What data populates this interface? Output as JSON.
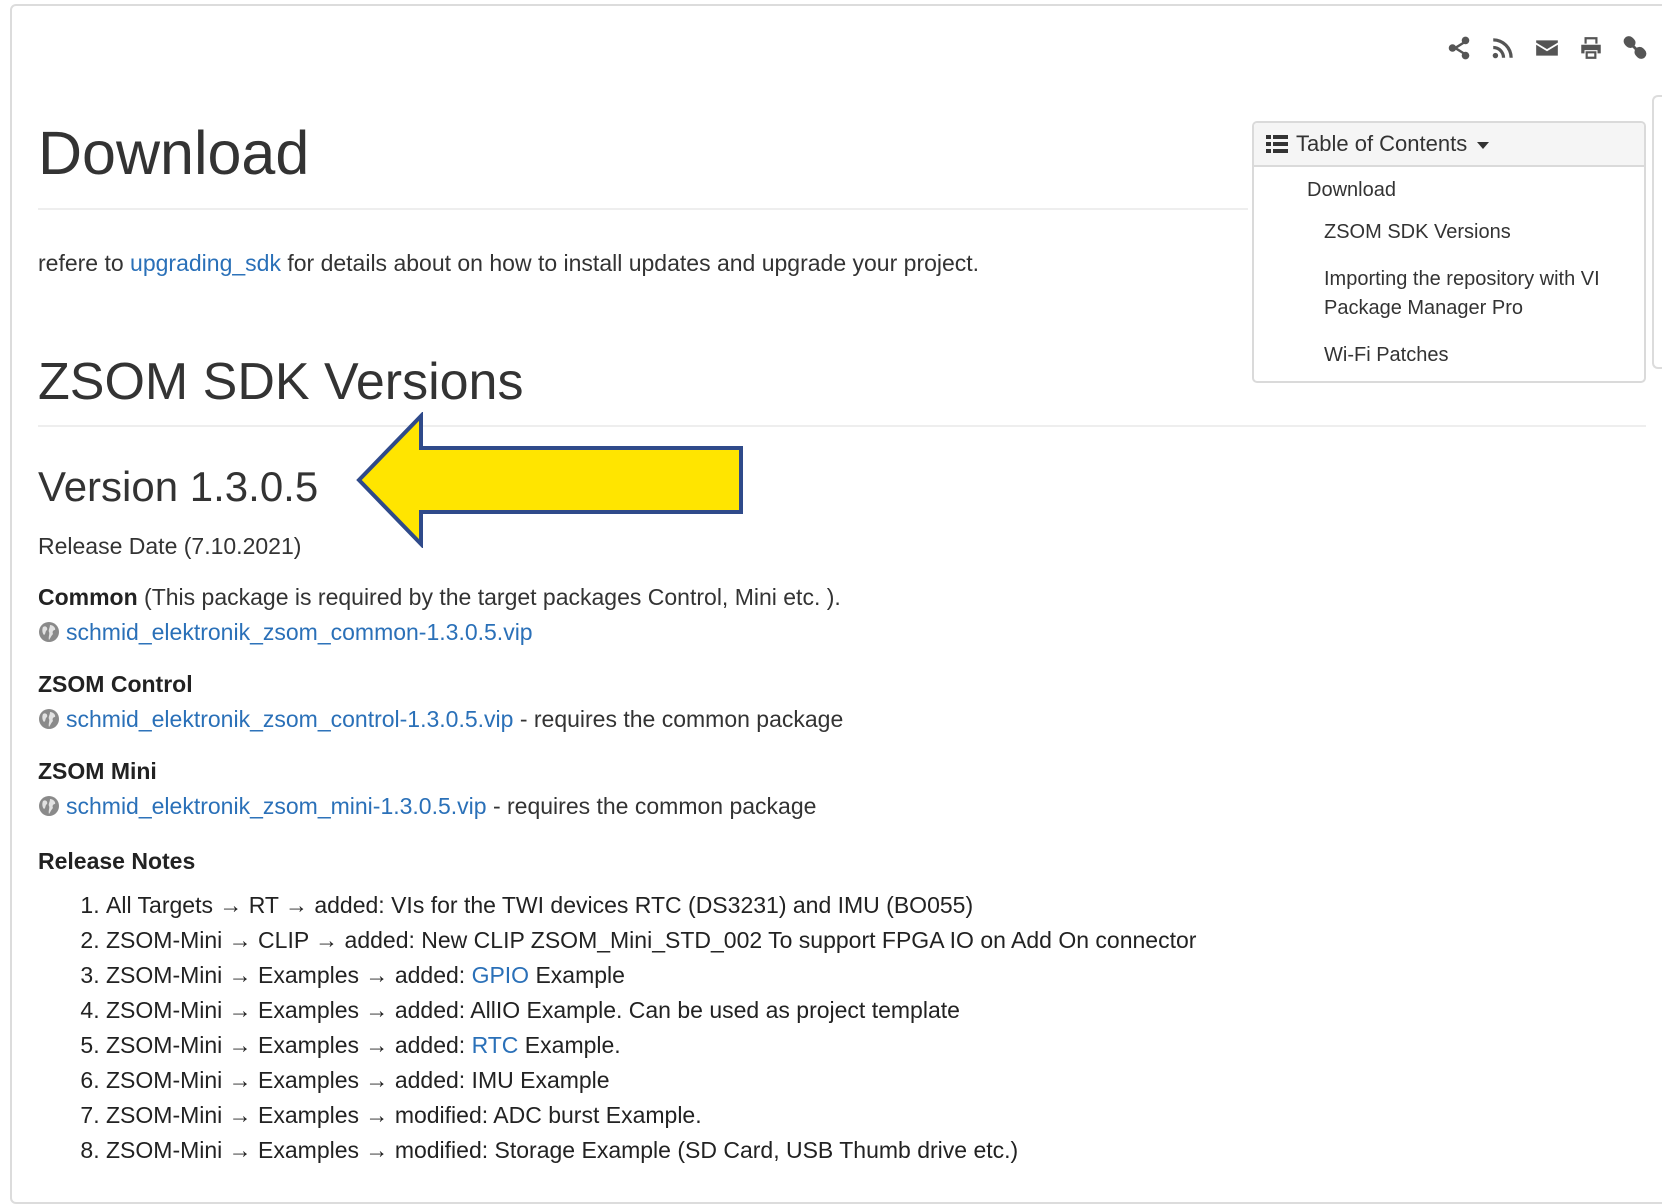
{
  "toolbar": {
    "icons": [
      "share-icon",
      "rss-icon",
      "envelope-icon",
      "print-icon",
      "link-icon"
    ]
  },
  "toc": {
    "title": "Table of Contents",
    "items": [
      {
        "label": "Download",
        "level": 1
      },
      {
        "label": "ZSOM SDK Versions",
        "level": 2
      },
      {
        "label": "Importing the repository with VI Package Manager Pro",
        "level": 2
      },
      {
        "label": "Wi-Fi Patches",
        "level": 2
      }
    ]
  },
  "main": {
    "title": "Download",
    "intro": {
      "prefix": "refere to ",
      "link": "upgrading_sdk",
      "suffix": " for details about on how to install updates and upgrade your project."
    },
    "section_title": "ZSOM SDK Versions",
    "version_title": "Version 1.3.0.5",
    "release_date": "Release Date (7.10.2021)",
    "packages": [
      {
        "name": "Common",
        "desc": " (This package is required by the target packages Control, Mini etc. ).",
        "file": "schmid_elektronik_zsom_common-1.3.0.5.vip",
        "note": ""
      },
      {
        "name": "ZSOM Control",
        "desc": "",
        "file": "schmid_elektronik_zsom_control-1.3.0.5.vip",
        "note": " - requires the common package"
      },
      {
        "name": "ZSOM Mini",
        "desc": "",
        "file": "schmid_elektronik_zsom_mini-1.3.0.5.vip",
        "note": " - requires the common package"
      }
    ],
    "release_notes_title": "Release Notes",
    "release_notes": [
      {
        "pre": "All Targets → RT → added: VIs for the TWI devices RTC (DS3231) and IMU (BO055)",
        "link": "",
        "post": ""
      },
      {
        "pre": "ZSOM-Mini → CLIP → added: New CLIP ZSOM_Mini_STD_002 To support FPGA IO on Add On connector",
        "link": "",
        "post": ""
      },
      {
        "pre": "ZSOM-Mini → Examples → added: ",
        "link": "GPIO",
        "post": " Example"
      },
      {
        "pre": "ZSOM-Mini → Examples → added: AllIO Example. Can be used as project template",
        "link": "",
        "post": ""
      },
      {
        "pre": "ZSOM-Mini → Examples → added: ",
        "link": "RTC",
        "post": " Example."
      },
      {
        "pre": "ZSOM-Mini → Examples → added: IMU Example",
        "link": "",
        "post": ""
      },
      {
        "pre": "ZSOM-Mini → Examples → modified: ADC burst Example.",
        "link": "",
        "post": ""
      },
      {
        "pre": "ZSOM-Mini → Examples → modified: Storage Example (SD Card, USB Thumb drive etc.)",
        "link": "",
        "post": ""
      }
    ]
  },
  "colors": {
    "link": "#2a70b8",
    "arrow_fill": "#ffe500",
    "arrow_stroke": "#2f4a8a"
  }
}
